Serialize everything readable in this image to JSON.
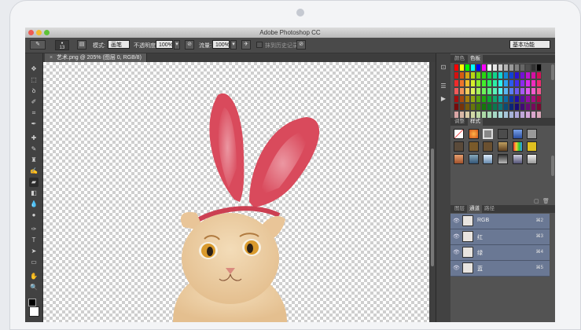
{
  "window": {
    "title": "Adobe Photoshop CC"
  },
  "options_bar": {
    "brush_size": "13",
    "mode_label": "模式:",
    "mode_value": "画笔",
    "opacity_label": "不透明度:",
    "opacity_value": "100%",
    "flow_label": "流量:",
    "flow_value": "100%",
    "erase_history_label": "抹到历史记录",
    "workspace": "基本功能"
  },
  "document": {
    "tab_label": "艺术.png @ 205% (图层 0, RGB/8)",
    "close_glyph": "×"
  },
  "panels": {
    "color_tabs": [
      "颜色",
      "色板"
    ],
    "adjust_tabs": [
      "调整",
      "样式"
    ],
    "layer_tabs": [
      "图层",
      "通道",
      "路径"
    ],
    "channels": [
      {
        "name": "RGB",
        "shortcut": "⌘2"
      },
      {
        "name": "红",
        "shortcut": "⌘3"
      },
      {
        "name": "绿",
        "shortcut": "⌘4"
      },
      {
        "name": "蓝",
        "shortcut": "⌘5"
      }
    ]
  },
  "colors": {
    "traffic_close": "#ee5b52",
    "traffic_min": "#f5bd2c",
    "traffic_max": "#5fc238",
    "channel_highlight": "#6a7894",
    "ears": "#d94a5c"
  },
  "tools": [
    "move-icon",
    "marquee-icon",
    "lasso-icon",
    "quick-select-icon",
    "crop-icon",
    "eyedropper-icon",
    "healing-icon",
    "brush-icon",
    "stamp-icon",
    "history-brush-icon",
    "eraser-icon",
    "gradient-icon",
    "blur-icon",
    "dodge-icon",
    "pen-icon",
    "type-icon",
    "path-select-icon",
    "shape-icon",
    "hand-icon",
    "zoom-icon"
  ]
}
